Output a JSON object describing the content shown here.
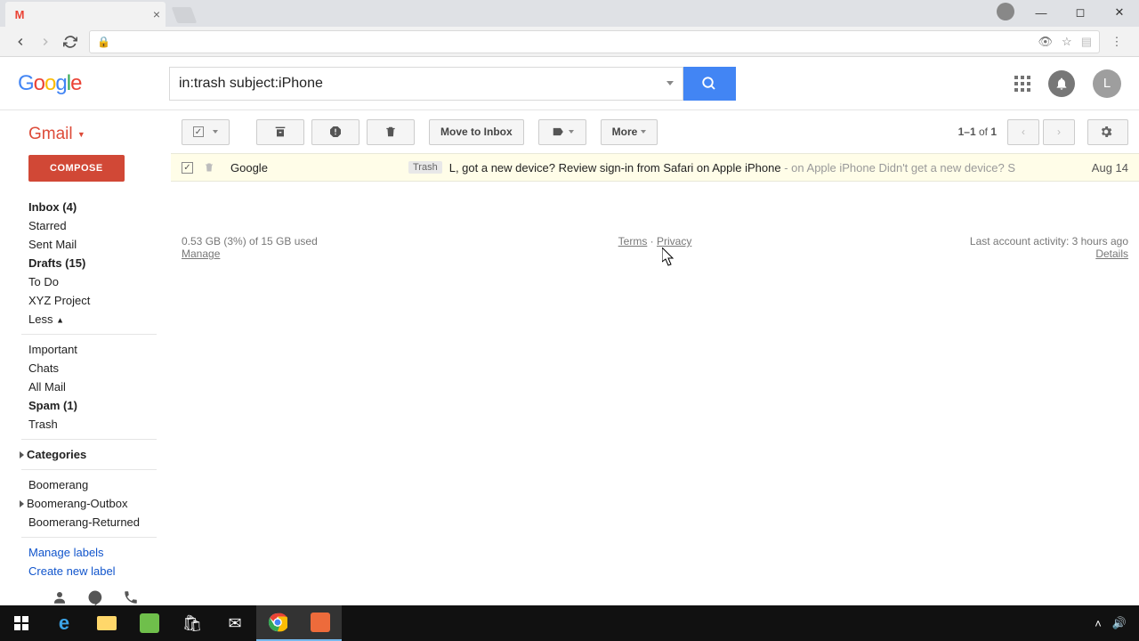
{
  "browser": {
    "tab_title": "",
    "lock": "🔒"
  },
  "header": {
    "search_value": "in:trash subject:iPhone",
    "avatar_letter": "L"
  },
  "sidebar": {
    "gmail": "Gmail",
    "compose": "COMPOSE",
    "items": [
      {
        "label": "Inbox (4)",
        "bold": true
      },
      {
        "label": "Starred"
      },
      {
        "label": "Sent Mail"
      },
      {
        "label": "Drafts (15)",
        "bold": true
      },
      {
        "label": "To Do"
      },
      {
        "label": "XYZ Project"
      }
    ],
    "less": "Less",
    "more_items": [
      {
        "label": "Important"
      },
      {
        "label": "Chats"
      },
      {
        "label": "All Mail"
      },
      {
        "label": "Spam (1)",
        "bold": true
      },
      {
        "label": "Trash"
      }
    ],
    "categories": "Categories",
    "label_items": [
      {
        "label": "Boomerang"
      },
      {
        "label": "Boomerang-Outbox",
        "expand": true
      },
      {
        "label": "Boomerang-Returned"
      }
    ],
    "manage_labels": "Manage labels",
    "create_label": "Create new label"
  },
  "toolbar": {
    "move_inbox": "Move to Inbox",
    "more": "More",
    "pagination": "1–1 of 1"
  },
  "message": {
    "sender": "Google",
    "trash_label": "Trash",
    "subject": "L, got a new device? Review sign-in from Safari on Apple iPhone",
    "snippet": " - on Apple iPhone Didn't get a new device? S",
    "date": "Aug 14"
  },
  "footer": {
    "storage": "0.53 GB (3%) of 15 GB used",
    "manage": "Manage",
    "terms": "Terms",
    "privacy": "Privacy",
    "activity": "Last account activity: 3 hours ago",
    "details": "Details"
  }
}
